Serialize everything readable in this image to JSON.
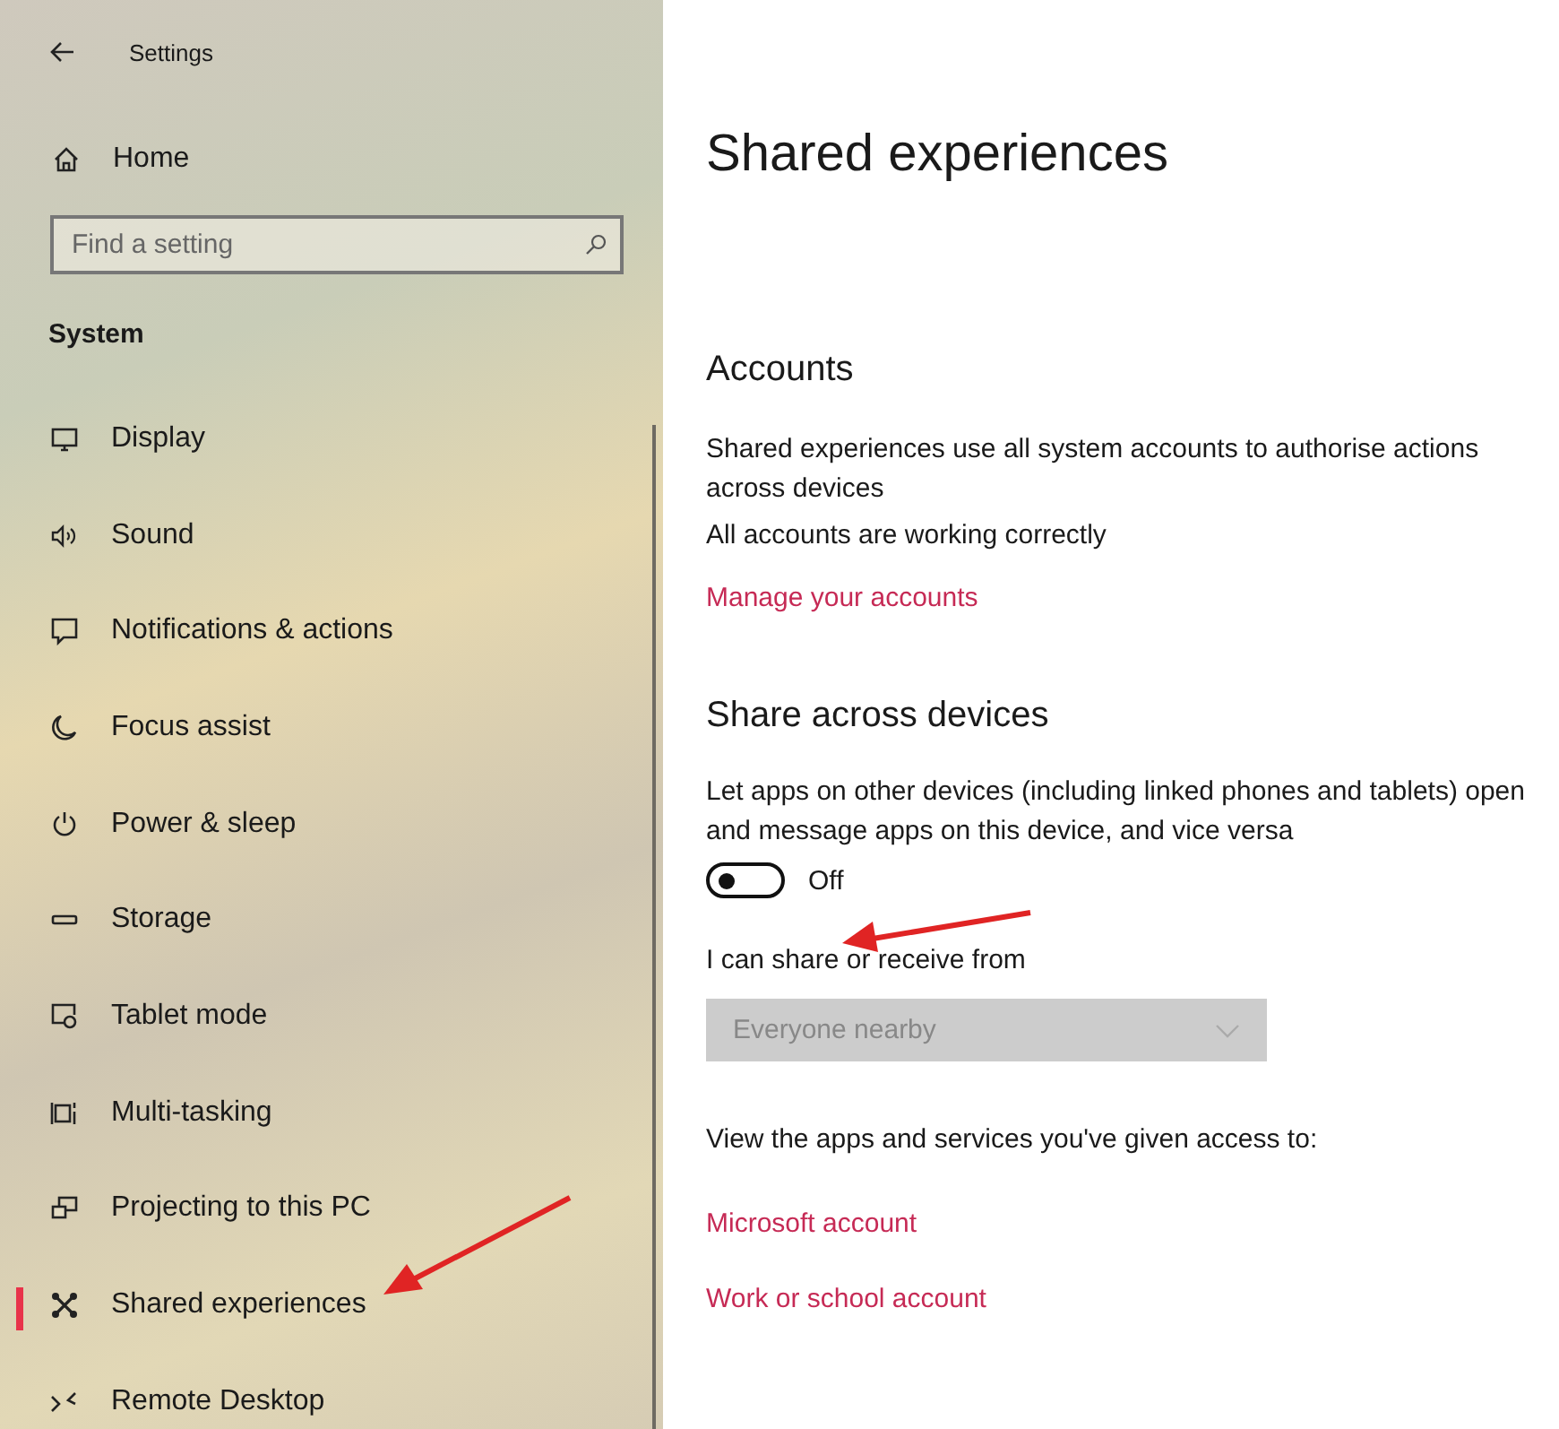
{
  "window": {
    "title": "Settings"
  },
  "sidebar": {
    "home": "Home",
    "search": {
      "placeholder": "Find a setting"
    },
    "section": "System",
    "items": [
      {
        "label": "Display",
        "selected": false
      },
      {
        "label": "Sound",
        "selected": false
      },
      {
        "label": "Notifications & actions",
        "selected": false
      },
      {
        "label": "Focus assist",
        "selected": false
      },
      {
        "label": "Power & sleep",
        "selected": false
      },
      {
        "label": "Storage",
        "selected": false
      },
      {
        "label": "Tablet mode",
        "selected": false
      },
      {
        "label": "Multi-tasking",
        "selected": false
      },
      {
        "label": "Projecting to this PC",
        "selected": false
      },
      {
        "label": "Shared experiences",
        "selected": true
      },
      {
        "label": "Remote Desktop",
        "selected": false
      }
    ]
  },
  "page": {
    "title": "Shared experiences",
    "accounts": {
      "heading": "Accounts",
      "description": "Shared experiences use all system accounts to authorise actions across devices",
      "status": "All accounts are working correctly",
      "link": "Manage your accounts"
    },
    "share": {
      "heading": "Share across devices",
      "description": "Let apps on other devices (including linked phones and tablets) open and message apps on this device, and vice versa",
      "toggle": {
        "on": false,
        "label": "Off"
      },
      "dropdown_label": "I can share or receive from",
      "dropdown": {
        "value": "Everyone nearby",
        "disabled": true
      },
      "access_text": "View the apps and services you've given access to:",
      "links": [
        "Microsoft account",
        "Work or school account"
      ]
    }
  }
}
